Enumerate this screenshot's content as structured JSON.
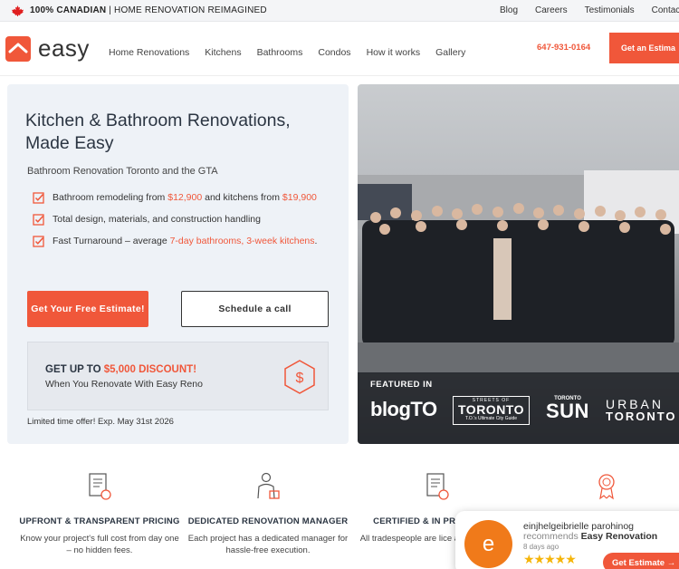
{
  "topbar": {
    "tagline_bold": "100% CANADIAN",
    "tagline_rest": "| HOME RENOVATION REIMAGINED",
    "links": [
      "Blog",
      "Careers",
      "Testimonials",
      "Contac"
    ]
  },
  "header": {
    "logo_text": "easy",
    "nav": [
      "Home Renovations",
      "Kitchens",
      "Bathrooms",
      "Condos",
      "How it works",
      "Gallery"
    ],
    "phone": "647-931-0164",
    "cta": "Get an Estima"
  },
  "hero": {
    "title": "Kitchen & Bathroom Renovations, Made Easy",
    "subtitle": "Bathroom Renovation Toronto and the GTA",
    "bullet1_a": "Bathroom remodeling from ",
    "bullet1_b": "$12,900",
    "bullet1_c": " and kitchens from ",
    "bullet1_d": "$19,900",
    "bullet2": "Total design, materials, and construction handling",
    "bullet3_a": "Fast Turnaround – average ",
    "bullet3_b": "7-day bathrooms, 3-week kitchens",
    "bullet3_c": ".",
    "btn_estimate": "Get Your Free Estimate!",
    "btn_call": "Schedule a call",
    "promo_title_a": "GET UP TO ",
    "promo_title_b": "$5,000 DISCOUNT!",
    "promo_sub": "When You Renovate With Easy Reno",
    "limited": "Limited time offer!   Exp. May 31st 2026"
  },
  "featured": {
    "label": "FEATURED IN",
    "blogto": "blogTO",
    "streets_top": "STREETS OF",
    "streets_main": "TORONTO",
    "streets_bottom": "T.O.'s Ultimate City Guide",
    "sun_top": "TORONTO",
    "sun_main": "SUN",
    "urban_1": "URBAN",
    "urban_2": "TORONTO"
  },
  "features": [
    {
      "icon": "document-icon",
      "title": "UPFRONT & TRANSPARENT PRICING",
      "desc": "Know your project's full cost from day one – no hidden fees."
    },
    {
      "icon": "manager-icon",
      "title": "DEDICATED RENOVATION MANAGER",
      "desc": "Each project has a dedicated manager for hassle-free execution."
    },
    {
      "icon": "certificate-icon",
      "title": "CERTIFIED & IN PROFESSION",
      "desc": "All tradespeople are lice and WSIB-regis"
    },
    {
      "icon": "award-icon",
      "title": "",
      "desc": ""
    }
  ],
  "review": {
    "avatar_letter": "e",
    "name": "einjhelgeibrielle parohinog",
    "recommends": "recommends ",
    "company": "Easy Renovation",
    "time": "8 days ago",
    "stars": "★★★★★",
    "button": "Get Estimate →"
  },
  "colors": {
    "accent": "#f0573a",
    "dark": "#2b3542",
    "panel": "#eef2f7"
  }
}
